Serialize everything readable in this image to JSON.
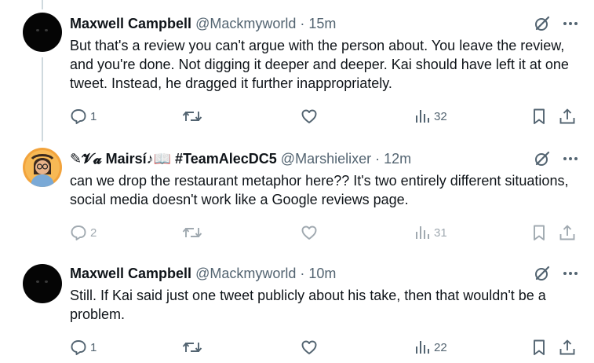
{
  "tweets": [
    {
      "name": "Maxwell Campbell",
      "handle": "@Mackmyworld",
      "separator": "·",
      "time": "15m",
      "text": "But that's a review you can't argue with the person about. You leave the review, and you're done. Not digging it deeper and deeper. Kai should have left it at one tweet. Instead, he dragged it further inappropriately.",
      "reply_count": "1",
      "view_count": "32"
    },
    {
      "name": "✎𝓥𝓪 Mairsí♪📖 #TeamAlecDC5",
      "handle": "@Marshielixer",
      "separator": "·",
      "time": "12m",
      "text": "can we drop the restaurant metaphor here?? It's two entirely different situations, social media doesn't work like a Google reviews page.",
      "reply_count": "2",
      "view_count": "31"
    },
    {
      "name": "Maxwell Campbell",
      "handle": "@Mackmyworld",
      "separator": "·",
      "time": "10m",
      "text": "Still. If Kai said just one tweet publicly about his take, then that wouldn't be a problem.",
      "reply_count": "1",
      "view_count": "22"
    }
  ],
  "icons": {
    "grok": "grok-icon",
    "more": "more-icon",
    "reply": "reply-icon",
    "retweet": "retweet-icon",
    "like": "like-icon",
    "views": "views-icon",
    "bookmark": "bookmark-icon",
    "share": "share-icon"
  },
  "colors": {
    "text": "#0f1419",
    "secondary": "#536471",
    "thread_line": "#cfd9de",
    "background": "#ffffff"
  }
}
